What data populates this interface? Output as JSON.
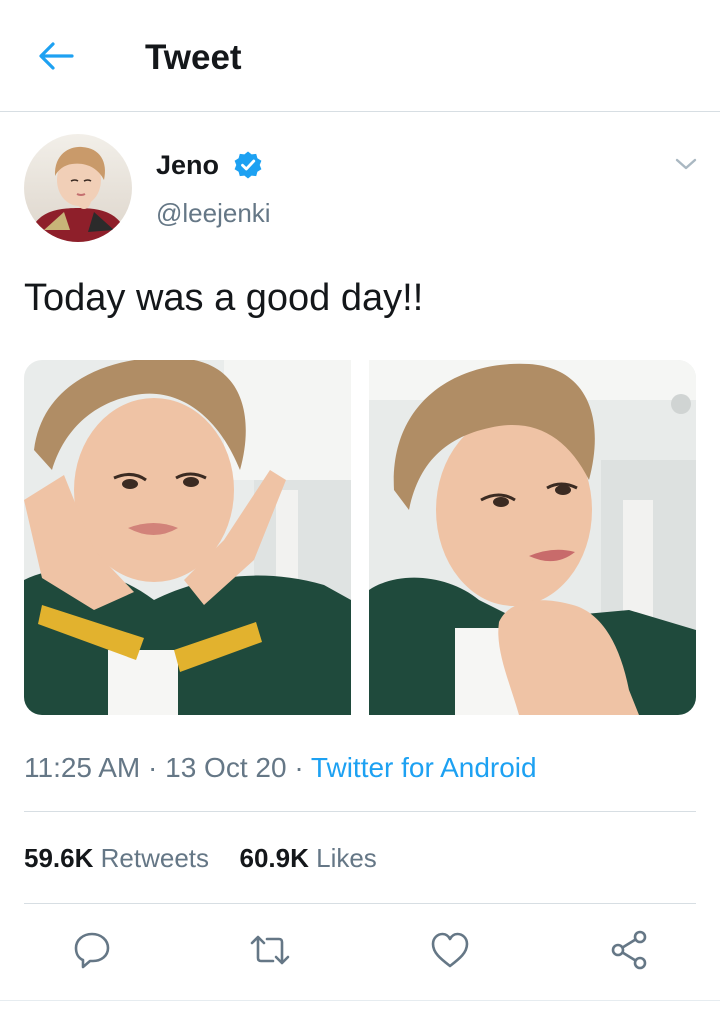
{
  "header": {
    "title": "Tweet",
    "back_icon": "back-arrow-icon"
  },
  "colors": {
    "accent": "#1da1f2",
    "text": "#14171a",
    "secondary": "#657786",
    "divider": "#d7dee3"
  },
  "tweet": {
    "author": {
      "display_name": "Jeno",
      "handle": "@leejenki",
      "verified": true,
      "avatar_alt": "profile photo"
    },
    "text": "Today was a good day!!",
    "media": [
      {
        "alt": "selfie with hands on cheeks"
      },
      {
        "alt": "selfie with hand under chin"
      }
    ],
    "time": "11:25 AM",
    "separator": "·",
    "date": "13 Oct 20",
    "source": "Twitter for Android"
  },
  "stats": {
    "retweets_count": "59.6K",
    "retweets_label": "Retweets",
    "likes_count": "60.9K",
    "likes_label": "Likes"
  },
  "actions": [
    {
      "icon": "reply-icon"
    },
    {
      "icon": "retweet-icon"
    },
    {
      "icon": "like-icon"
    },
    {
      "icon": "share-icon"
    }
  ]
}
